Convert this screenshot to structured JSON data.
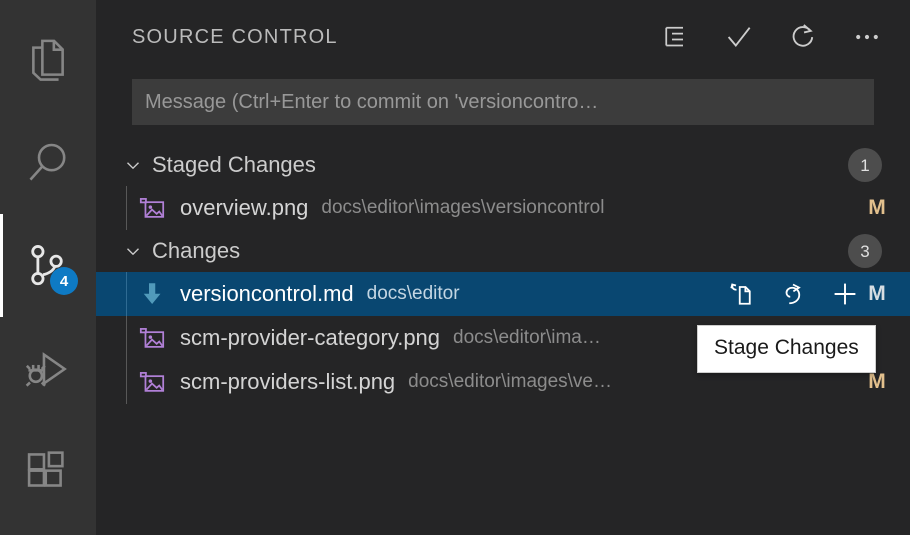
{
  "activity_bar": {
    "items": [
      {
        "name": "explorer",
        "icon": "files-icon",
        "active": false,
        "badge": null
      },
      {
        "name": "search",
        "icon": "search-icon",
        "active": false,
        "badge": null
      },
      {
        "name": "source-control",
        "icon": "source-control-icon",
        "active": true,
        "badge": "4"
      },
      {
        "name": "run-and-debug",
        "icon": "run-and-debug-icon",
        "active": false,
        "badge": null
      },
      {
        "name": "extensions",
        "icon": "extensions-icon",
        "active": false,
        "badge": null
      }
    ]
  },
  "sidebar": {
    "title": "SOURCE CONTROL",
    "actions": [
      {
        "name": "view-as-list",
        "icon": "list-icon",
        "label": "View as List"
      },
      {
        "name": "commit",
        "icon": "check-icon",
        "label": "Commit"
      },
      {
        "name": "refresh",
        "icon": "refresh-icon",
        "label": "Refresh"
      },
      {
        "name": "more-actions",
        "icon": "ellipsis-icon",
        "label": "More Actions..."
      }
    ]
  },
  "commit_message": {
    "value": "",
    "placeholder": "Message (Ctrl+Enter to commit on 'versioncontro…"
  },
  "groups": [
    {
      "label": "Staged Changes",
      "count": "1",
      "expanded": true,
      "files": [
        {
          "name": "overview.png",
          "path": "docs\\editor\\images\\versioncontrol",
          "icon": "image-file-icon",
          "status": "M",
          "selected": false,
          "actions": []
        }
      ]
    },
    {
      "label": "Changes",
      "count": "3",
      "expanded": true,
      "files": [
        {
          "name": "versioncontrol.md",
          "path": "docs\\editor",
          "icon": "markdown-file-icon",
          "status": "M",
          "selected": true,
          "actions": [
            {
              "name": "open-file-button",
              "icon": "open-file-icon"
            },
            {
              "name": "discard-changes-button",
              "icon": "discard-icon"
            },
            {
              "name": "stage-changes-button",
              "icon": "plus-icon"
            }
          ]
        },
        {
          "name": "scm-provider-category.png",
          "path": "docs\\editor\\ima…",
          "icon": "image-file-icon",
          "status": "",
          "selected": false,
          "actions": []
        },
        {
          "name": "scm-providers-list.png",
          "path": "docs\\editor\\images\\ve…",
          "icon": "image-file-icon",
          "status": "M",
          "selected": false,
          "actions": []
        }
      ]
    }
  ],
  "tooltip": {
    "text": "Stage Changes",
    "visible": true
  },
  "colors": {
    "activity_bar_bg": "#333333",
    "sidebar_bg": "#252526",
    "selection_bg": "#094771",
    "badge_bg": "#0e7ac4",
    "status_modified": "#e2c08d",
    "input_bg": "#3c3c3c",
    "image_icon": "#b180d7",
    "markdown_icon": "#519aba"
  }
}
